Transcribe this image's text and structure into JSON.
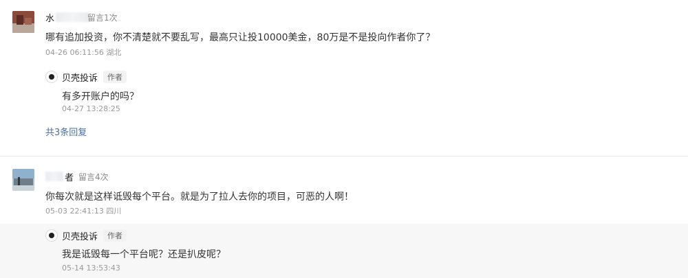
{
  "comments": [
    {
      "username_visible_start": "水",
      "username_visible_end": "",
      "count_badge": "留言1次",
      "text": "哪有追加投资，你不清楚就不要乱写，最高只让投10000美金，80万是不是投向作者你了？",
      "timestamp": "04-26 06:11:56",
      "location": "湖北",
      "reply": {
        "author": "贝壳投诉",
        "author_tag": "作者",
        "text": "有多开账户的吗？",
        "timestamp": "04-27 13:28:25"
      },
      "more_replies": "共3条回复"
    },
    {
      "username_visible_start": "",
      "username_visible_end": "者",
      "count_badge": "留言4次",
      "text": "你每次就是这样诋毁每个平台。就是为了拉人去你的项目，可恶的人啊！",
      "timestamp": "05-03 22:41:13",
      "location": "四川",
      "reply": {
        "author": "贝壳投诉",
        "author_tag": "作者",
        "text": "我是诋毁每一个平台呢？还是扒皮呢？",
        "timestamp": "05-14 13:53:43"
      }
    }
  ]
}
